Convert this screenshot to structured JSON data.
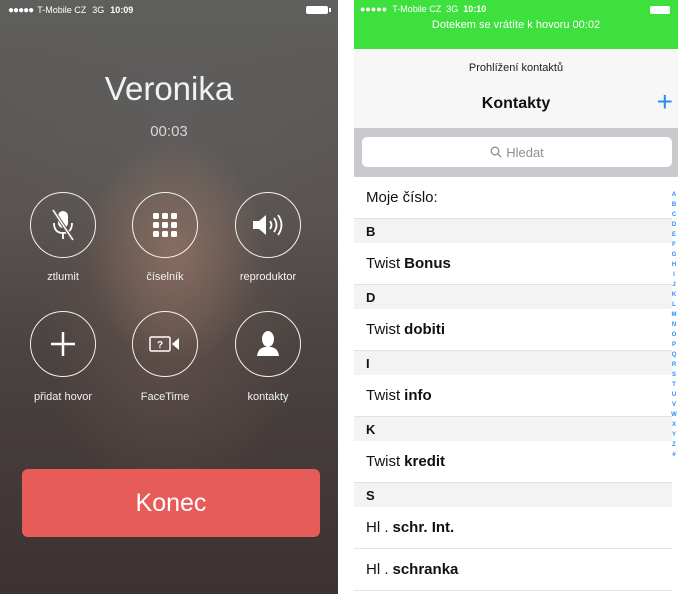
{
  "call": {
    "status": {
      "signal": "●●●●●",
      "carrier": "T-Mobile CZ",
      "network": "3G",
      "time": "10:09"
    },
    "caller_name": "Veronika",
    "duration": "00:03",
    "buttons": [
      {
        "label": "ztlumit",
        "icon": "microphone-muted-icon"
      },
      {
        "label": "číselník",
        "icon": "keypad-icon"
      },
      {
        "label": "reproduktor",
        "icon": "speaker-icon"
      },
      {
        "label": "přidat hovor",
        "icon": "plus-icon"
      },
      {
        "label": "FaceTime",
        "icon": "facetime-icon"
      },
      {
        "label": "kontakty",
        "icon": "contact-person-icon"
      }
    ],
    "end_label": "Konec",
    "end_color": "#e75b58"
  },
  "contacts": {
    "status": {
      "signal": "●●●●●",
      "carrier": "T-Mobile CZ",
      "network": "3G",
      "time": "10:10"
    },
    "return_banner": "Dotekem se vrátíte k hovoru 00:02",
    "banner_color": "#3ee03d",
    "nav_subtitle": "Prohlížení kontaktů",
    "nav_title": "Kontakty",
    "add_label": "+",
    "search_placeholder": "Hledat",
    "my_number_label": "Moje číslo:",
    "sections": [
      {
        "letter": "B",
        "rows": [
          {
            "first": "Twist",
            "last": "Bonus"
          }
        ]
      },
      {
        "letter": "D",
        "rows": [
          {
            "first": "Twist",
            "last": "dobiti"
          }
        ]
      },
      {
        "letter": "I",
        "rows": [
          {
            "first": "Twist",
            "last": "info"
          }
        ]
      },
      {
        "letter": "K",
        "rows": [
          {
            "first": "Twist",
            "last": "kredit"
          }
        ]
      },
      {
        "letter": "S",
        "rows": [
          {
            "first": "Hl .",
            "last": "schr. Int."
          },
          {
            "first": "Hl .",
            "last": "schranka"
          }
        ]
      }
    ],
    "index_letters": [
      "A",
      "B",
      "C",
      "D",
      "E",
      "F",
      "G",
      "H",
      "I",
      "J",
      "K",
      "L",
      "M",
      "N",
      "O",
      "P",
      "Q",
      "R",
      "S",
      "T",
      "U",
      "V",
      "W",
      "X",
      "Y",
      "Z",
      "#"
    ],
    "accent_color": "#2b8cf3"
  }
}
